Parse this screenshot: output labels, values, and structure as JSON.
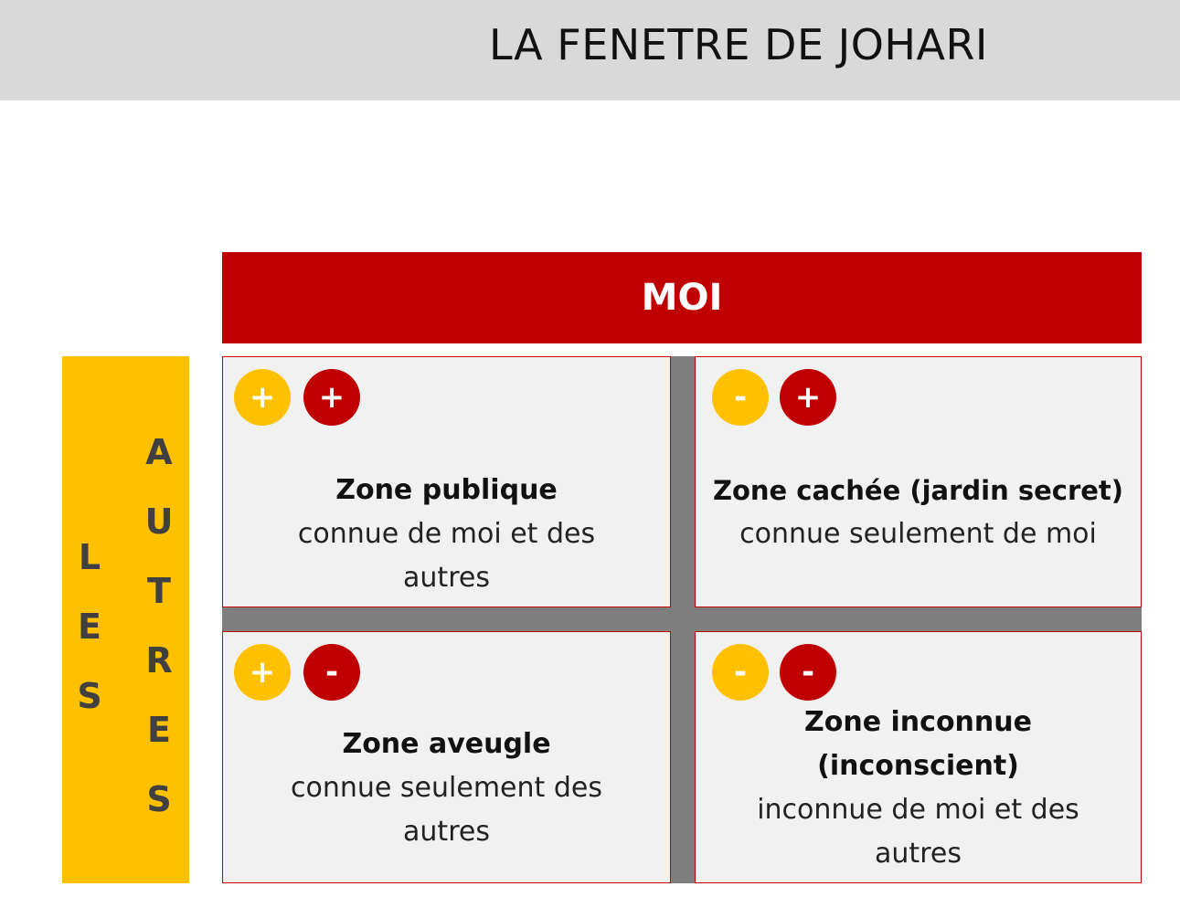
{
  "title": "LA FENETRE DE JOHARI",
  "top_header": "MOI",
  "side_header": {
    "word1": [
      "L",
      "E",
      "S"
    ],
    "word2": [
      "A",
      "U",
      "T",
      "R",
      "E",
      "S"
    ]
  },
  "colors": {
    "red": "#c00000",
    "yellow": "#ffc000",
    "grey_grid": "#7f7f7f",
    "cell_bg": "#f2f1f2",
    "title_bar": "#d9d9d9"
  },
  "zones": [
    {
      "badges": [
        {
          "sign": "+",
          "color": "yellow"
        },
        {
          "sign": "+",
          "color": "red"
        }
      ],
      "title": "Zone publique",
      "description": [
        "connue de moi et des",
        "autres"
      ]
    },
    {
      "badges": [
        {
          "sign": "-",
          "color": "yellow"
        },
        {
          "sign": "+",
          "color": "red"
        }
      ],
      "title": "Zone cachée (jardin secret)",
      "description": [
        "connue seulement de moi"
      ]
    },
    {
      "badges": [
        {
          "sign": "+",
          "color": "yellow"
        },
        {
          "sign": "-",
          "color": "red"
        }
      ],
      "title": "Zone aveugle",
      "description": [
        "connue seulement des",
        "autres"
      ]
    },
    {
      "badges": [
        {
          "sign": "-",
          "color": "yellow"
        },
        {
          "sign": "-",
          "color": "red"
        }
      ],
      "title_lines": [
        "Zone inconnue",
        "(inconscient)"
      ],
      "description": [
        "inconnue de moi et des",
        "autres"
      ]
    }
  ]
}
